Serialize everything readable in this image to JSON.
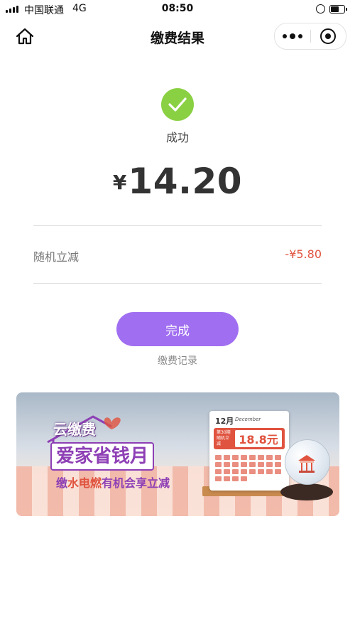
{
  "status_bar": {
    "carrier": "中国联通",
    "network": "4G",
    "time": "08:50"
  },
  "nav": {
    "title": "缴费结果"
  },
  "result": {
    "status_text": "成功",
    "currency_symbol": "¥",
    "amount": "14.20",
    "discount_label": "随机立减",
    "discount_value": "-¥5.80",
    "done_label": "完成",
    "records_label": "缴费记录"
  },
  "banner": {
    "brand": "云缴费",
    "campaign": "爱家省钱月",
    "slogan_prefix": "缴",
    "slogan_highlight": "水电燃",
    "slogan_suffix": "有机会享立减",
    "calendar_month": "12月",
    "calendar_month_en": "December",
    "promo_small": "第30期 随机立减",
    "promo_amount": "18.8元"
  },
  "colors": {
    "accent": "#a06ef0",
    "success": "#8ad043",
    "discount": "#e0533f",
    "banner_purple": "#8e3fb5"
  },
  "icons": {
    "home": "home-icon",
    "more": "more-dots-icon",
    "close": "target-close-icon",
    "success": "checkmark-icon"
  }
}
